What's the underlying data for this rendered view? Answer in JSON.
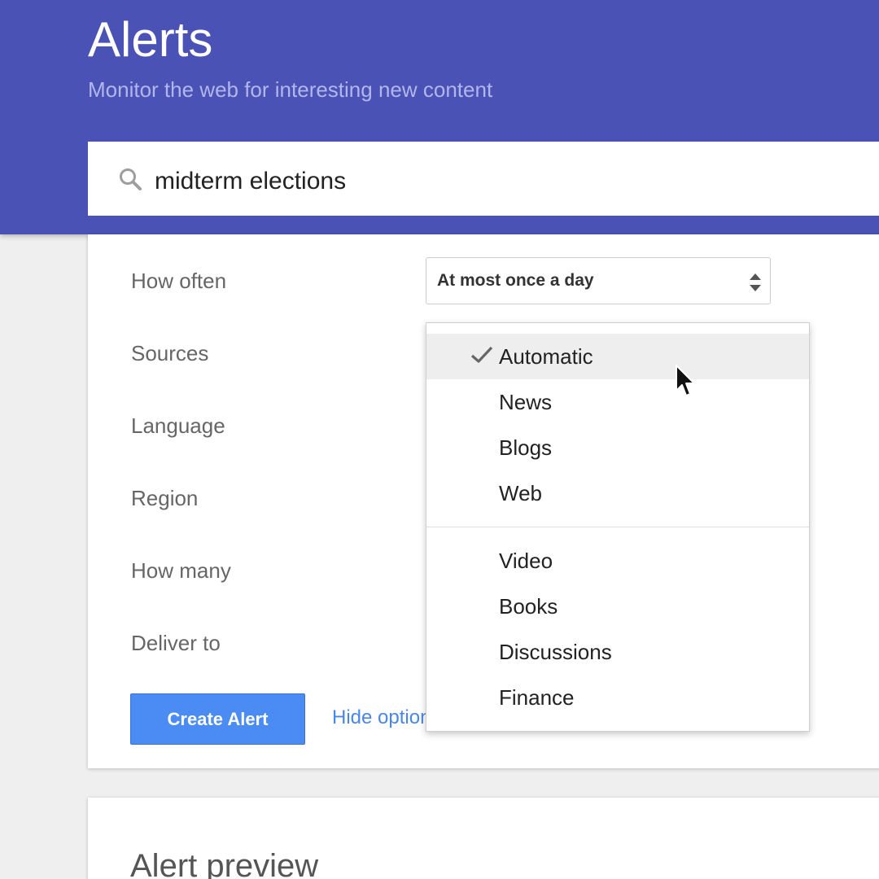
{
  "header": {
    "title": "Alerts",
    "subtitle": "Monitor the web for interesting new content",
    "background_color": "#4a52b5"
  },
  "search": {
    "icon": "search-icon",
    "value": "midterm elections"
  },
  "options": {
    "labels": [
      "How often",
      "Sources",
      "Language",
      "Region",
      "How many",
      "Deliver to"
    ],
    "how_often": {
      "selected": "At most once a day",
      "icon": "up-down-arrows-icon"
    },
    "create_button_label": "Create Alert",
    "hide_options_label": "Hide options",
    "button_color": "#4b8bf4",
    "link_color": "#4a86e8"
  },
  "sources_menu": {
    "selected": "Automatic",
    "check_icon": "checkmark-icon",
    "group_primary": [
      "Automatic",
      "News",
      "Blogs",
      "Web"
    ],
    "group_secondary": [
      "Video",
      "Books",
      "Discussions",
      "Finance"
    ]
  },
  "preview": {
    "title": "Alert preview"
  },
  "cursor": "arrow-cursor-icon"
}
